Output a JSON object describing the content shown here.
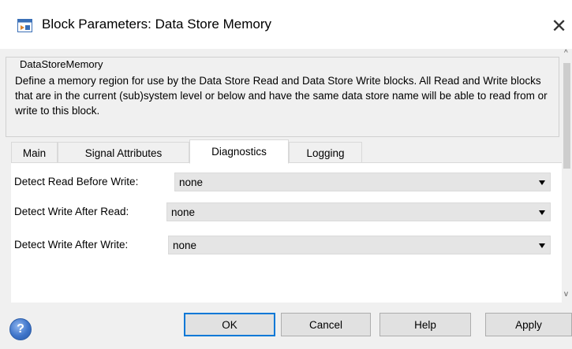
{
  "window": {
    "title": "Block Parameters: Data Store Memory",
    "close_glyph": "✕"
  },
  "group": {
    "legend": "DataStoreMemory",
    "description": "Define a memory region for use by the Data Store Read and Data Store Write blocks. All Read and Write blocks that are in the current (sub)system level or below and have the same data store name will be able to read from or write to this block."
  },
  "tabs": [
    {
      "label": "Main",
      "active": false
    },
    {
      "label": "Signal Attributes",
      "active": false
    },
    {
      "label": "Diagnostics",
      "active": true
    },
    {
      "label": "Logging",
      "active": false
    }
  ],
  "diagnostics": {
    "rows": [
      {
        "label": "Detect Read Before Write:",
        "value": "none"
      },
      {
        "label": "Detect Write After Read:",
        "value": "none"
      },
      {
        "label": "Detect Write After Write:",
        "value": "none"
      }
    ]
  },
  "scrollbar": {
    "up_glyph": "^",
    "down_glyph": "v"
  },
  "buttons": {
    "help_icon_glyph": "?",
    "ok": "OK",
    "cancel": "Cancel",
    "help": "Help",
    "apply": "Apply"
  }
}
